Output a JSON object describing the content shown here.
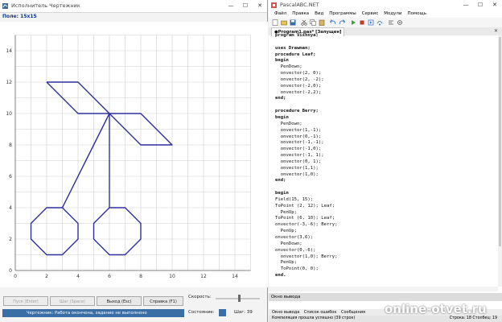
{
  "left_window": {
    "title": "Исполнитель Чертежник",
    "field_label": "Поле: 15x15",
    "buttons": {
      "start": "Пуск (Enter)",
      "step": "Шаг (Space)",
      "exit": "Выход (Esc)",
      "help": "Справка (F1)"
    },
    "speed_label": "Скорость:",
    "state_label": "Состояние:",
    "step_counter": "Шаг: 39",
    "status_text": "Чертежник:  Работа окончена, задание не выполнено",
    "controls": {
      "minimize": "—",
      "maximize": "☐",
      "close": "✕"
    }
  },
  "chart_data": {
    "type": "line",
    "title": "",
    "xlim": [
      0,
      15
    ],
    "ylim": [
      0,
      15
    ],
    "x_ticks": [
      "0",
      "2",
      "4",
      "6",
      "8",
      "10",
      "12",
      "14"
    ],
    "y_ticks": [
      "0",
      "2",
      "4",
      "6",
      "8",
      "10",
      "12",
      "14"
    ],
    "grid": true,
    "series": [
      {
        "color": "#2f2f9e",
        "points": [
          [
            2,
            12
          ],
          [
            4,
            12
          ],
          [
            6,
            10
          ],
          [
            4,
            10
          ],
          [
            2,
            12
          ]
        ]
      },
      {
        "color": "#2f2f9e",
        "points": [
          [
            6,
            10
          ],
          [
            8,
            8
          ],
          [
            10,
            8
          ],
          [
            8,
            10
          ],
          [
            6,
            10
          ]
        ]
      },
      {
        "color": "#2f2f9e",
        "points": [
          [
            6,
            10
          ],
          [
            3,
            4
          ]
        ]
      },
      {
        "color": "#2f2f9e",
        "points": [
          [
            3,
            4
          ],
          [
            4,
            3
          ],
          [
            4,
            2
          ],
          [
            3,
            1
          ],
          [
            2,
            1
          ],
          [
            1,
            2
          ],
          [
            1,
            3
          ],
          [
            2,
            4
          ],
          [
            3,
            4
          ]
        ]
      },
      {
        "color": "#2f2f9e",
        "points": [
          [
            6,
            10
          ],
          [
            6,
            4
          ]
        ]
      },
      {
        "color": "#2f2f9e",
        "points": [
          [
            6,
            4
          ],
          [
            7,
            4
          ],
          [
            8,
            3
          ],
          [
            8,
            2
          ],
          [
            7,
            1
          ],
          [
            6,
            1
          ],
          [
            5,
            2
          ],
          [
            5,
            3
          ],
          [
            6,
            4
          ]
        ]
      }
    ]
  },
  "right_window": {
    "title": "PascalABC.NET",
    "menu": [
      "Файл",
      "Правка",
      "Вид",
      "Программы",
      "Сервис",
      "Модули",
      "Помощь"
    ],
    "tab": "●Program1.pas* [Запущен]",
    "output_title": "Окно вывода",
    "bottom_tabs": [
      "Окно вывода",
      "Список ошибок",
      "Сообщения"
    ],
    "statusbar_left": "Компиляция прошла успешно (39 строк)",
    "statusbar_right": "Строка: 18  Столбец: 19",
    "controls": {
      "minimize": "—",
      "maximize": "☐",
      "close": "✕"
    },
    "code_lines": [
      "program Vishnya;",
      "",
      "uses Drawman;",
      "procedure Leaf;",
      "begin",
      "  PenDown;",
      "  onvector(2, 0);",
      "  onvector(2, -2);",
      "  onvector(-2,0);",
      "  onvector(-2,2);",
      "end;",
      "",
      "procedure Berry;",
      "begin",
      "  PenDown;",
      "  onvector(1,-1);",
      "  onvector(0,-1);",
      "  onvector(-1,-1);",
      "  onvector(-1,0);",
      "  onvector(-1, 1);",
      "  onvector(0, 1);",
      "  onvector(1,1);",
      "  onvector(1,0);",
      "end;",
      "",
      "begin",
      "Field(15, 15);",
      "ToPoint (2, 12); Leaf;",
      "  PenUp;",
      "ToPoint (6, 10); Leaf;",
      "onvector(-3,-6); Berry;",
      "  PenUp;",
      "onvector(3,6);",
      "  PenDown;",
      "onvector(0,-6);",
      "  onvector(1,0); Berry;",
      "  PenUp;",
      "  ToPoint(0, 0);",
      "end."
    ]
  },
  "watermark": "online-otvet.ru"
}
